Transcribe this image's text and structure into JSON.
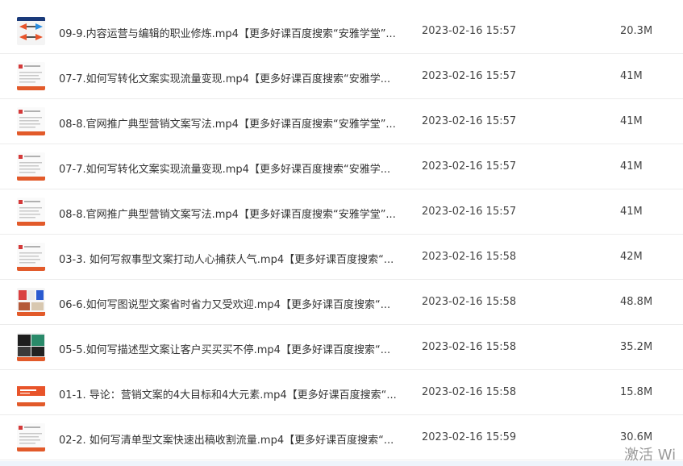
{
  "files": [
    {
      "name": "09-9.内容运营与编辑的职业修炼.mp4【更多好课百度搜索“安雅学堂”...",
      "date": "2023-02-16 15:57",
      "size": "20.3M",
      "thumb": "thumb-arrows"
    },
    {
      "name": "07-7.如何写转化文案实现流量变现.mp4【更多好课百度搜索“安雅学...",
      "date": "2023-02-16 15:57",
      "size": "41M",
      "thumb": "thumb-slide"
    },
    {
      "name": "08-8.官网推广典型营销文案写法.mp4【更多好课百度搜索“安雅学堂”...",
      "date": "2023-02-16 15:57",
      "size": "41M",
      "thumb": "thumb-slide"
    },
    {
      "name": "07-7.如何写转化文案实现流量变现.mp4【更多好课百度搜索“安雅学...",
      "date": "2023-02-16 15:57",
      "size": "41M",
      "thumb": "thumb-slide"
    },
    {
      "name": "08-8.官网推广典型营销文案写法.mp4【更多好课百度搜索“安雅学堂”...",
      "date": "2023-02-16 15:57",
      "size": "41M",
      "thumb": "thumb-slide"
    },
    {
      "name": "03-3. 如何写叙事型文案打动人心捕获人气.mp4【更多好课百度搜索“...",
      "date": "2023-02-16 15:58",
      "size": "42M",
      "thumb": "thumb-slide"
    },
    {
      "name": "06-6.如何写图说型文案省时省力又受欢迎.mp4【更多好课百度搜索“...",
      "date": "2023-02-16 15:58",
      "size": "48.8M",
      "thumb": "thumb-images"
    },
    {
      "name": "05-5.如何写描述型文案让客户买买买不停.mp4【更多好课百度搜索“...",
      "date": "2023-02-16 15:58",
      "size": "35.2M",
      "thumb": "thumb-dark"
    },
    {
      "name": "01-1. 导论：营销文案的4大目标和4大元素.mp4【更多好课百度搜索“...",
      "date": "2023-02-16 15:58",
      "size": "15.8M",
      "thumb": "thumb-orange"
    },
    {
      "name": "02-2. 如何写清单型文案快速出稿收割流量.mp4【更多好课百度搜索“...",
      "date": "2023-02-16 15:59",
      "size": "30.6M",
      "thumb": "thumb-slide"
    }
  ],
  "watermark": "激活 Wi"
}
